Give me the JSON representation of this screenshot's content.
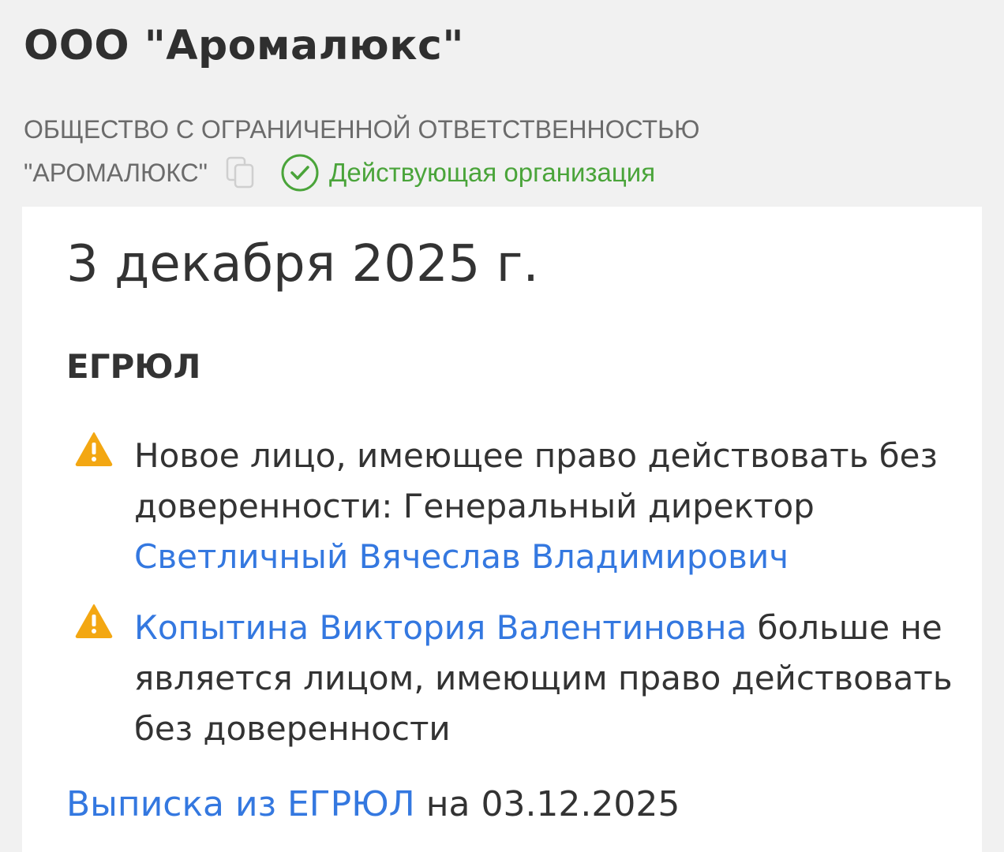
{
  "header": {
    "title": "ООО \"Аромалюкс\"",
    "full_name_line1": "ОБЩЕСТВО С ОГРАНИЧЕННОЙ ОТВЕТСТВЕННОСТЬЮ",
    "full_name_line2": "\"АРОМАЛЮКС\"",
    "copy_icon": "copy-icon",
    "status": {
      "icon": "check-circle-icon",
      "text": "Действующая организация",
      "color": "#4aa43a"
    }
  },
  "card": {
    "date": "3 декабря 2025 г.",
    "section": "ЕГРЮЛ",
    "events": [
      {
        "icon": "warning-icon",
        "text_before": "Новое лицо, имеющее право действовать без доверенности: Генеральный директор ",
        "link": "Светличный Вячеслав Владимирович",
        "text_after": ""
      },
      {
        "icon": "warning-icon",
        "text_before": "",
        "link": "Копытина Виктория Валентиновна",
        "text_after": " больше не является лицом, имеющим право действовать без доверенности"
      }
    ],
    "extract": {
      "link": "Выписка из ЕГРЮЛ",
      "suffix": " на 03.12.2025"
    }
  },
  "colors": {
    "link": "#3478e0",
    "warning": "#f3a712",
    "status_green": "#4aa43a"
  }
}
